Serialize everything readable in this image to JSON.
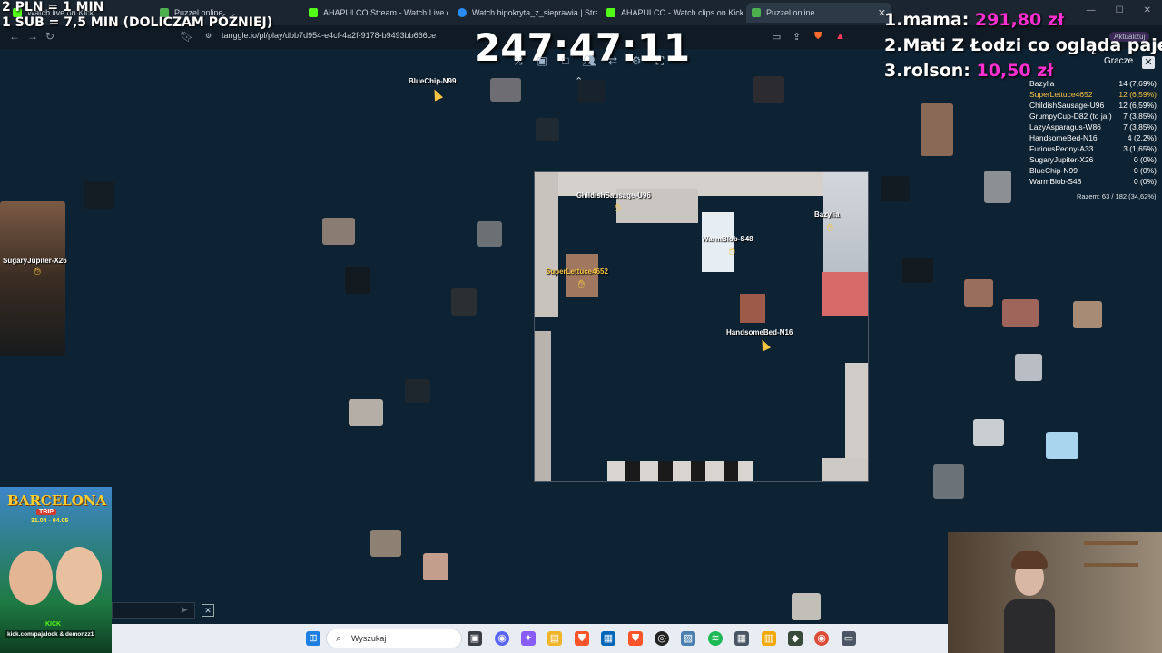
{
  "browser": {
    "tabs": [
      {
        "label": "Watch live on Kick",
        "icon_color": "#53fc18",
        "active": false
      },
      {
        "label": "Puzzel online",
        "icon_color": "#4caf50",
        "active": false
      },
      {
        "label": "AHAPULCO Stream - Watch Live on K",
        "icon_color": "#53fc18",
        "active": false
      },
      {
        "label": "Watch hipokryta_z_sieprawia | Stream",
        "icon_color": "#2a8bf2",
        "active": false
      },
      {
        "label": "AHAPULCO - Watch clips on Kick",
        "icon_color": "#53fc18",
        "active": false
      },
      {
        "label": "Puzzel online",
        "icon_color": "#4caf50",
        "active": true
      }
    ],
    "url": "tanggle.io/pl/play/dbb7d954-e4cf-4a2f-9178-b9493bb666ce",
    "aktualizuj_label": "Aktualizuj"
  },
  "overlay": {
    "line1": "2 PLN = 1 MIN",
    "line2": "1 SUB = 7,5 MIN (DOLICZAM PÓŹNIEJ)",
    "timer": "247:47:11"
  },
  "donors": [
    {
      "rank": "1.",
      "name": "mama:",
      "amount": "291,80 zł"
    },
    {
      "rank": "2.",
      "name": "Mati Z Łodzi co ogląda paje od",
      "amount": ""
    },
    {
      "rank": "3.",
      "name": "rolson:",
      "amount": "10,50 zł"
    }
  ],
  "board": {
    "cursors": [
      {
        "name": "BlueChip-N99"
      },
      {
        "name": "ChildishSausage-U96"
      },
      {
        "name": "Bazylia"
      },
      {
        "name": "WarmBlob-S48"
      },
      {
        "name": "SuperLettuce4652"
      },
      {
        "name": "HandsomeBed-N16"
      },
      {
        "name": "SugaryJupiter-X26"
      }
    ]
  },
  "players_panel": {
    "header": "Gracze",
    "close": "✕",
    "rows": [
      {
        "name": "Bazylia",
        "score": "14 (7,69%)",
        "highlight": false
      },
      {
        "name": "SuperLettuce4652",
        "score": "12 (6,59%)",
        "highlight": true
      },
      {
        "name": "ChildishSausage-U96",
        "score": "12 (6,59%)",
        "highlight": false
      },
      {
        "name": "GrumpyCup-D82 (to ja!)",
        "score": "7 (3,85%)",
        "highlight": false
      },
      {
        "name": "LazyAsparagus-W86",
        "score": "7 (3,85%)",
        "highlight": false
      },
      {
        "name": "HandsomeBed-N16",
        "score": "4 (2,2%)",
        "highlight": false
      },
      {
        "name": "FuriousPeony-A33",
        "score": "3 (1,65%)",
        "highlight": false
      },
      {
        "name": "SugaryJupiter-X26",
        "score": "0 (0%)",
        "highlight": false
      },
      {
        "name": "BlueChip-N99",
        "score": "0 (0%)",
        "highlight": false
      },
      {
        "name": "WarmBlob-S48",
        "score": "0 (0%)",
        "highlight": false
      }
    ],
    "total": "Razem: 63 / 182 (34,62%)"
  },
  "promo": {
    "title": "BARCELONA",
    "subtitle": "TRIP",
    "dates": "31.04 - 04.05",
    "kick": "KICK",
    "handles": "kick.com/pajalock & demonzz1"
  },
  "taskbar": {
    "search_placeholder": "Wyszukaj"
  }
}
